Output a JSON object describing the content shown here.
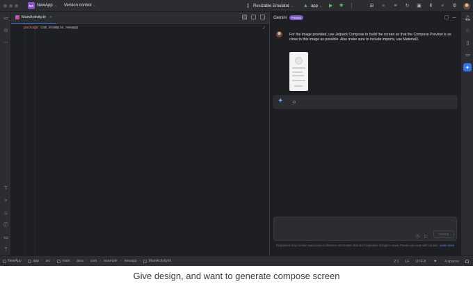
{
  "titlebar": {
    "project_badge": "NA",
    "project_name": "NewApp",
    "version_control": "Version control",
    "device": "Resizable Emulator",
    "run_config": "app"
  },
  "editor": {
    "tab": {
      "label": "MainActivity.kt"
    },
    "code": {
      "keyword": "package",
      "rest": " com.example.newapp"
    }
  },
  "gemini": {
    "title": "Gemini",
    "badge": "Preview",
    "prompt": "For the image provided, use Jetpack Compose to build the screen so that the Compose Preview is as close to this image as possible. Also make sure to include imports, use Material3.",
    "submit_label": "Submit",
    "disclaimer": "Responses may contain inaccurate or offensive information that don't represent Google's views. Please use code with caution.",
    "learn_more": "Learn more"
  },
  "statusbar": {
    "breadcrumbs": [
      "NewApp",
      "app",
      "src",
      "main",
      "java",
      "com",
      "example",
      "newapp",
      "MainActivity.kt"
    ],
    "position": "2:1",
    "line_ending": "LF",
    "encoding": "UTF-8",
    "indent": "4 spaces"
  },
  "caption": "Give design, and want to generate compose screen",
  "colors": {
    "accent": "#3574f0",
    "badge": "#7b5cc4",
    "project_badge": "#8a4fd1",
    "background": "#1e1f22",
    "panel": "#2b2d30"
  }
}
